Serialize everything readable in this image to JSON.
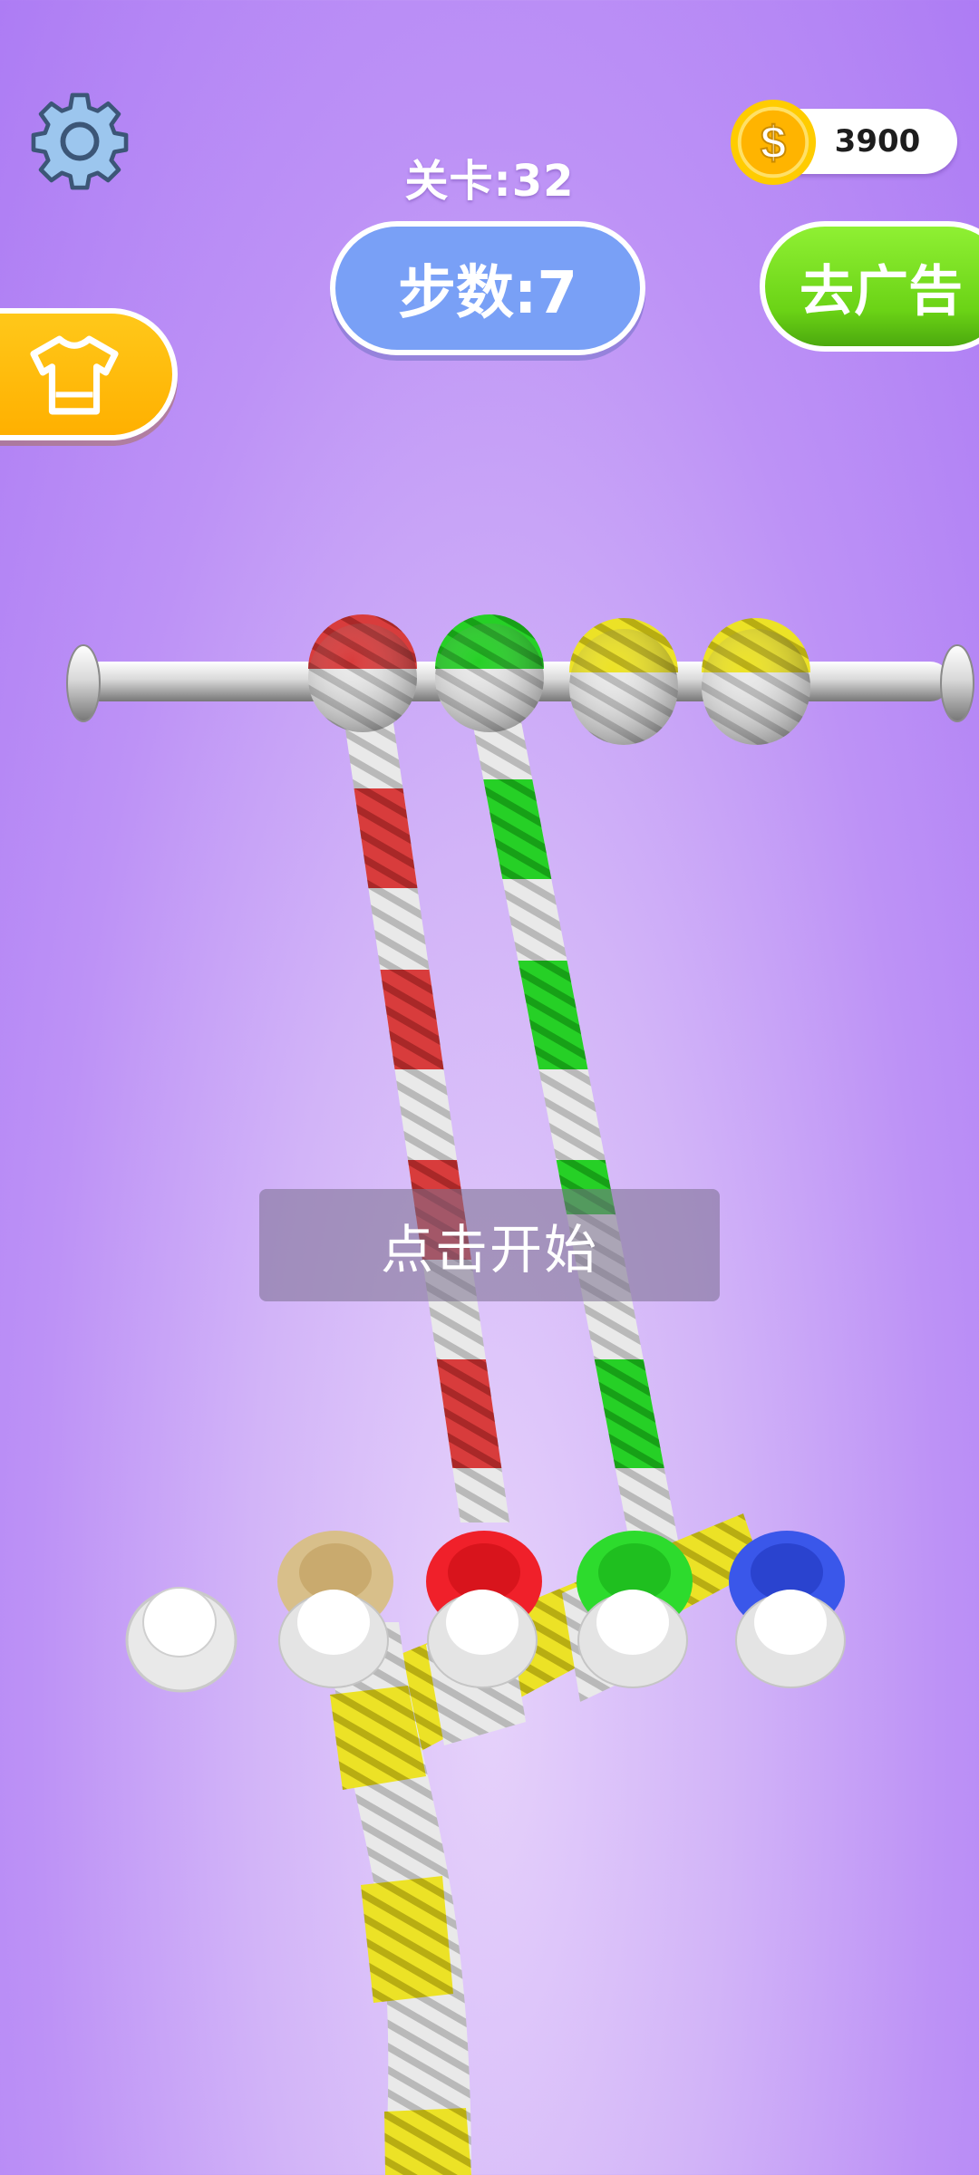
{
  "header": {
    "level_text": "关卡:32",
    "coins": "3900",
    "coin_symbol": "$"
  },
  "buttons": {
    "steps_label": "步数:7",
    "remove_ads_label": "去广告"
  },
  "overlay": {
    "tap_to_start": "点击开始"
  },
  "icons": {
    "settings": "gear-icon",
    "coin": "coin-icon",
    "skin_shop": "tshirt-icon"
  },
  "game": {
    "top_knots": [
      "red",
      "green",
      "yellow",
      "yellow"
    ],
    "pegs": [
      "white",
      "tan",
      "red",
      "green",
      "blue"
    ]
  },
  "colors": {
    "steps_button": "#79a0f6",
    "ad_button": "#6bd316",
    "shirt_button": "#ffbe10",
    "rope_white": "#e8e8e8",
    "rope_red": "#d63a3a",
    "rope_green": "#22cc22",
    "rope_yellow": "#e8dc22",
    "peg_tan": "#d8bf8a",
    "peg_red": "#f0202a",
    "peg_green": "#2ddb2d",
    "peg_blue": "#3a57ea"
  }
}
